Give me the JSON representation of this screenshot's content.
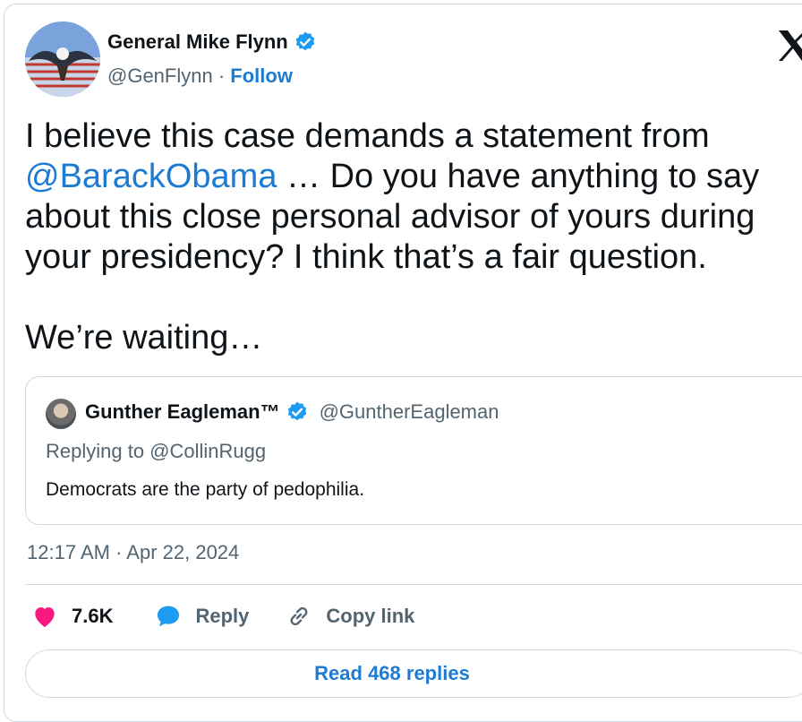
{
  "author": {
    "name": "General Mike Flynn",
    "handle": "@GenFlynn",
    "separator": "·",
    "follow_label": "Follow",
    "avatar_icon": "eagle-flag-avatar",
    "verified_icon": "verified-badge-icon"
  },
  "tweet": {
    "line1": "I believe this case demands a statement from\n",
    "mention": "@BarackObama",
    "rest": " … Do you have anything to say\nabout this close personal advisor of yours during\nyour presidency? I think that’s a fair question.\n\nWe’re waiting…"
  },
  "quoted": {
    "name": "Gunther Eagleman™",
    "handle": "@GuntherEagleman",
    "replying_to": "Replying to @CollinRugg",
    "text": "Democrats are the party of pedophilia."
  },
  "timestamp": "12:17 AM · Apr 22, 2024",
  "actions": {
    "likes": "7.6K",
    "reply_label": "Reply",
    "copy_label": "Copy link"
  },
  "read_replies_label": "Read 468 replies",
  "colors": {
    "accent": "#1d7bd3",
    "verified": "#1d9bf0",
    "like": "#f91880",
    "muted": "#536471",
    "border": "#cfd9de"
  }
}
